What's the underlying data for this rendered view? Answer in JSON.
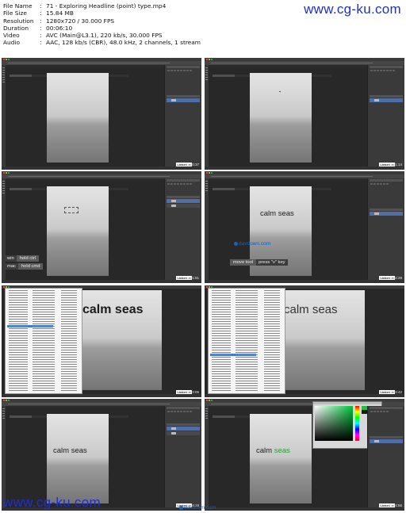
{
  "file_info": [
    {
      "key": "File Name",
      "value": "71 - Exploring Headline (point) type.mp4"
    },
    {
      "key": "File Size",
      "value": "15.84 MB"
    },
    {
      "key": "Resolution",
      "value": "1280x720 / 30.000 FPS"
    },
    {
      "key": "Duration",
      "value": "00:06:10"
    },
    {
      "key": "Video",
      "value": "AVC (Main@L3.1), 220 kb/s, 30.000 FPS"
    },
    {
      "key": "Audio",
      "value": "AAC, 128 kb/s (CBR), 48.0 kHz, 2 channels, 1 stream"
    }
  ],
  "watermark": "www.cg-ku.com",
  "linkedin_label": "Linked in",
  "frames": [
    {
      "timestamp": "00:00:37"
    },
    {
      "timestamp": "00:01:14"
    },
    {
      "timestamp": "00:01:51"
    },
    {
      "timestamp": "00:02:28"
    },
    {
      "timestamp": "00:03:05"
    },
    {
      "timestamp": "00:03:42"
    },
    {
      "timestamp": "00:04:19"
    },
    {
      "timestamp": "00:04:56"
    }
  ],
  "canvas_text": "calm seas",
  "shortcuts": {
    "win": "win",
    "win_key": "hold ctrl",
    "mac": "mac",
    "mac_key": "hold cmd",
    "tool": "move tool",
    "tool_key": "press \"v\" key"
  },
  "davdown": "davdown.com",
  "colors": {
    "watermark": "#1f2fd0",
    "green_text": "#2e9a3c"
  }
}
